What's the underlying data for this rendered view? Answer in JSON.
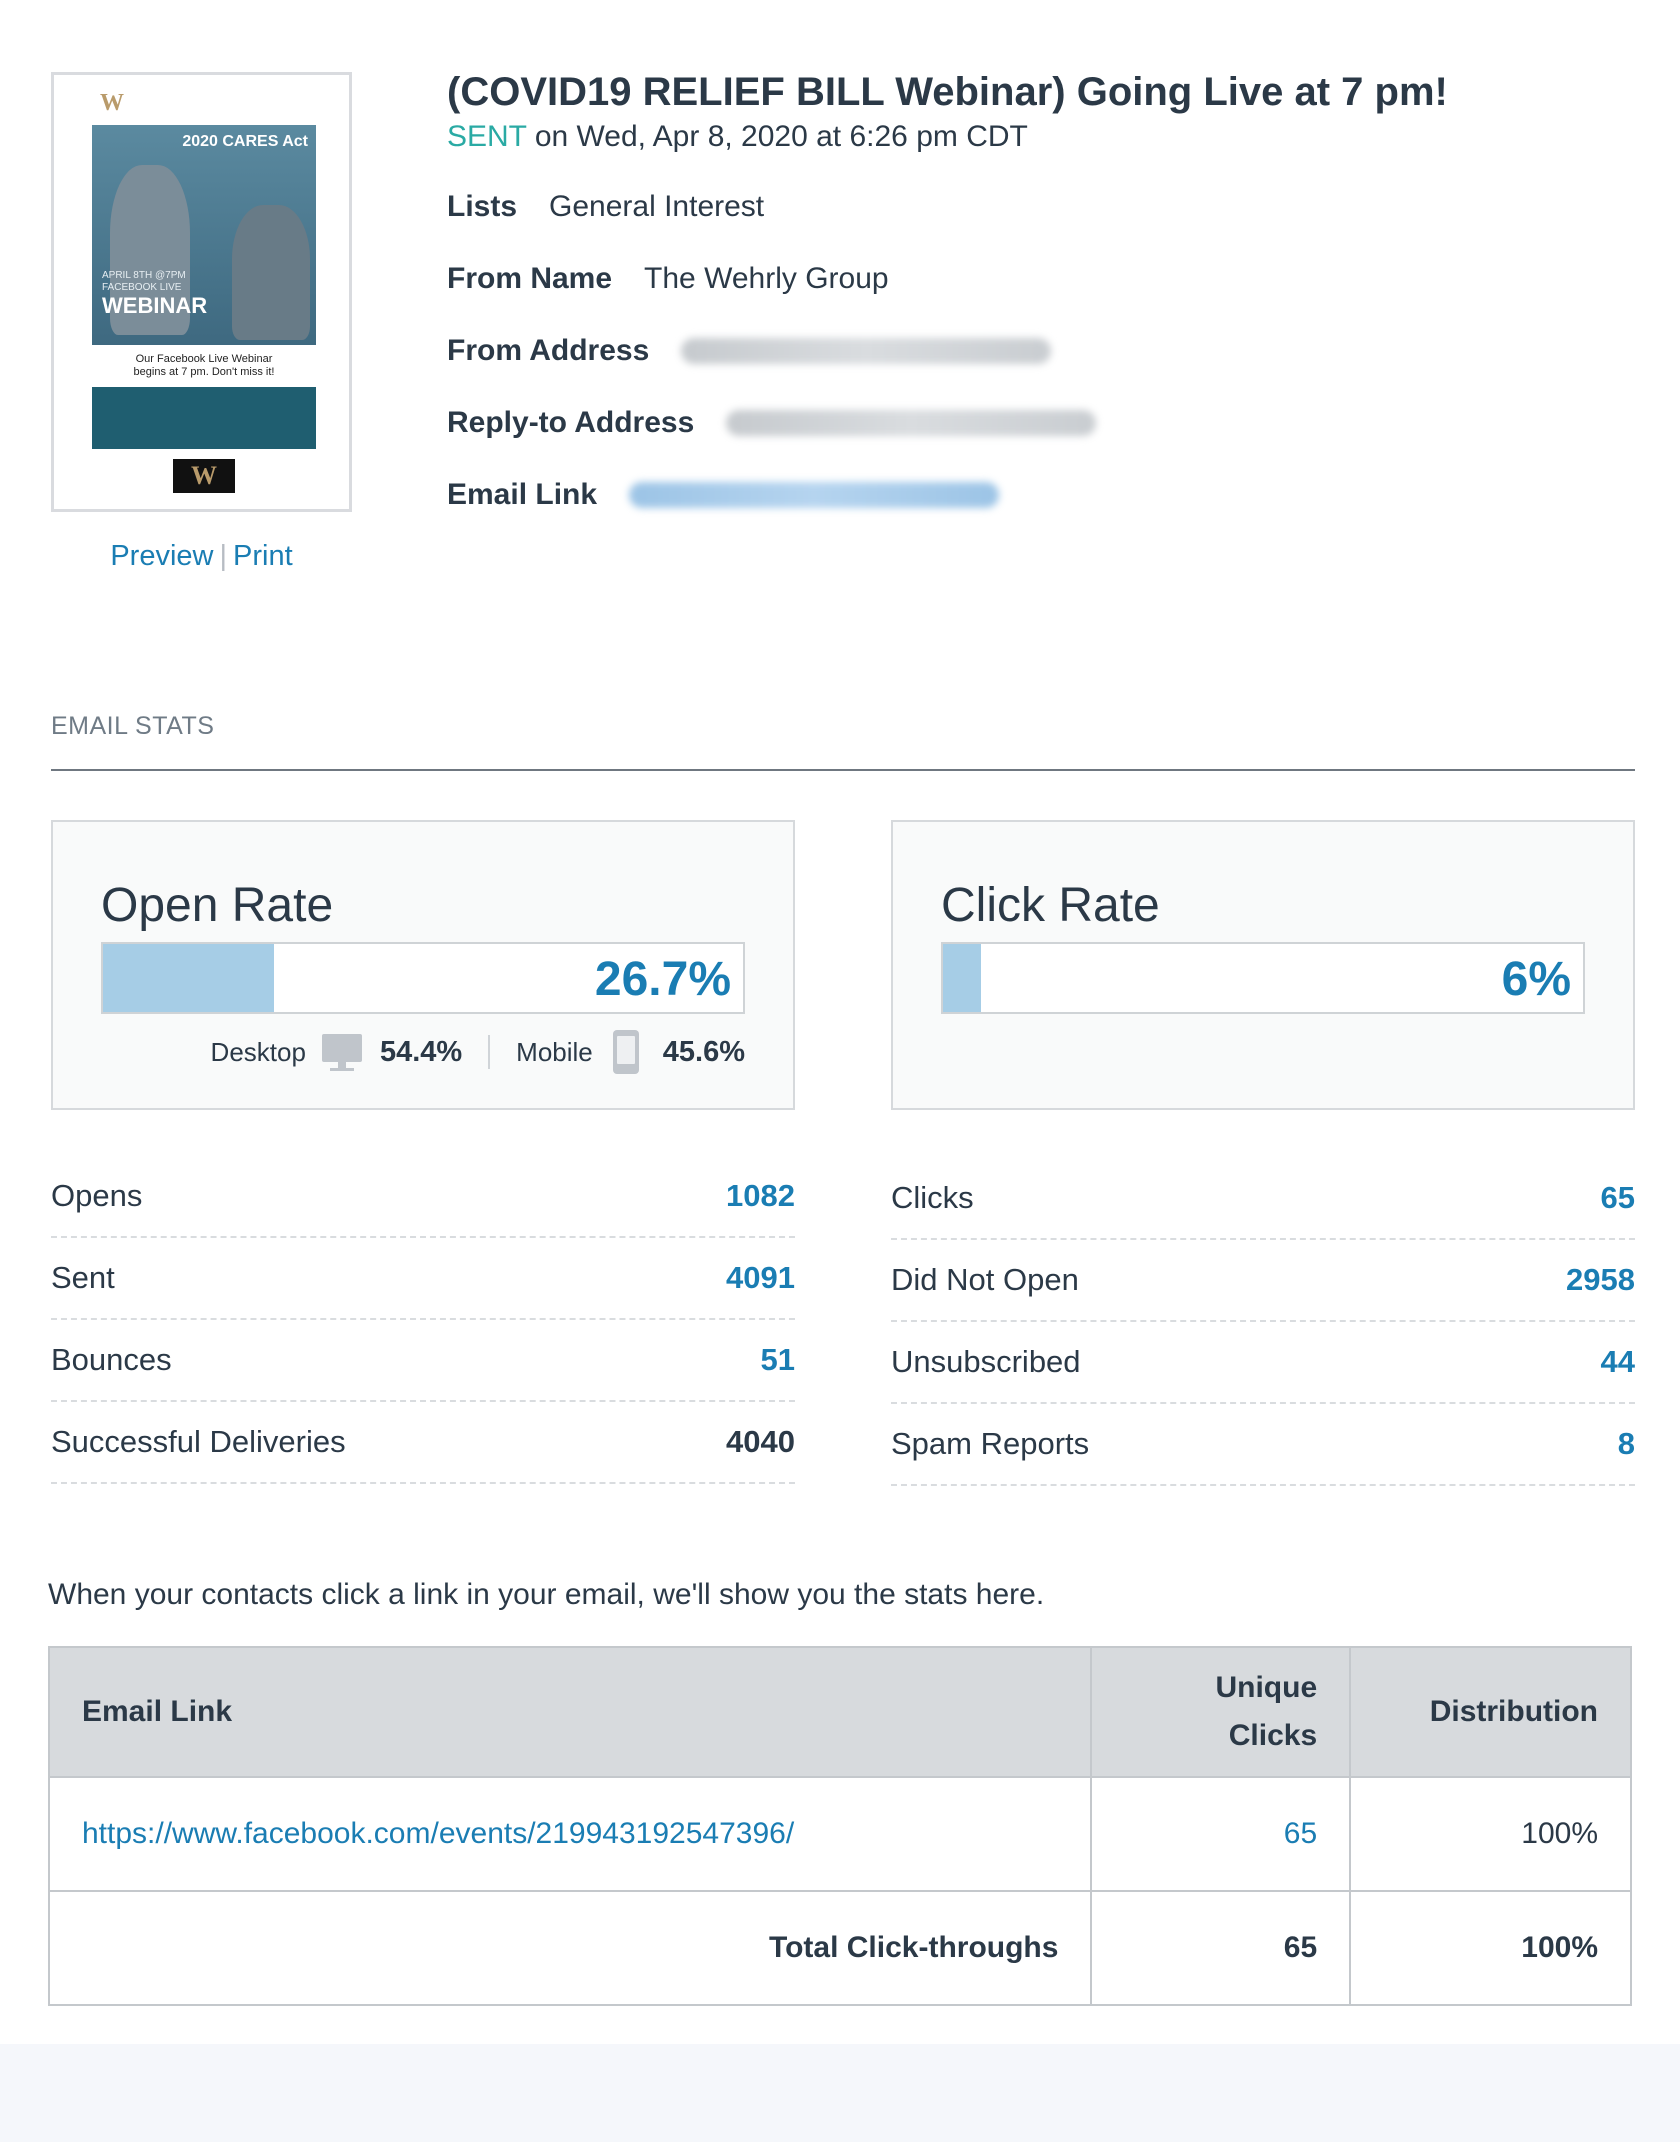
{
  "campaign": {
    "title": "(COVID19 RELIEF BILL Webinar) Going Live at 7 pm!",
    "status": "SENT",
    "sent_on": "on Wed, Apr 8, 2020 at 6:26 pm CDT",
    "preview_label": "Preview",
    "print_label": "Print",
    "separator": "|"
  },
  "thumbnail": {
    "headline": "2020 CARES Act",
    "subhead": "APRIL 8TH @7PM",
    "subhead2": "FACEBOOK LIVE",
    "main": "WEBINAR",
    "caption_line1": "Our Facebook Live Webinar",
    "caption_line2": "begins at 7 pm. Don't miss it!"
  },
  "details": {
    "lists_label": "Lists",
    "lists_value": "General Interest",
    "from_name_label": "From Name",
    "from_name_value": "The Wehrly Group",
    "from_address_label": "From Address",
    "reply_to_label": "Reply-to Address",
    "email_link_label": "Email Link"
  },
  "stats": {
    "section_label": "EMAIL STATS",
    "open_rate": {
      "title": "Open Rate",
      "value_label": "26.7%",
      "fraction": 0.267,
      "desktop_label": "Desktop",
      "desktop_pct": "54.4%",
      "mobile_label": "Mobile",
      "mobile_pct": "45.6%"
    },
    "click_rate": {
      "title": "Click Rate",
      "value_label": "6%",
      "fraction": 0.06
    },
    "left": [
      {
        "label": "Opens",
        "value": "1082"
      },
      {
        "label": "Sent",
        "value": "4091"
      },
      {
        "label": "Bounces",
        "value": "51"
      },
      {
        "label": "Successful Deliveries",
        "value": "4040"
      }
    ],
    "right": [
      {
        "label": "Clicks",
        "value": "65"
      },
      {
        "label": "Did Not Open",
        "value": "2958"
      },
      {
        "label": "Unsubscribed",
        "value": "44"
      },
      {
        "label": "Spam Reports",
        "value": "8"
      }
    ]
  },
  "links": {
    "note": "When your contacts click a link in your email, we'll show you the stats here.",
    "headers": {
      "link": "Email Link",
      "unique_line1": "Unique",
      "unique_line2": "Clicks",
      "distribution": "Distribution"
    },
    "rows": [
      {
        "url": "https://www.facebook.com/events/219943192547396/",
        "unique": "65",
        "distribution": "100%"
      }
    ],
    "total": {
      "label": "Total Click-throughs",
      "unique": "65",
      "distribution": "100%"
    }
  },
  "colors": {
    "accent": "#1a7db3",
    "sent": "#2aaaa4",
    "bar_fill": "#a6cde6"
  }
}
